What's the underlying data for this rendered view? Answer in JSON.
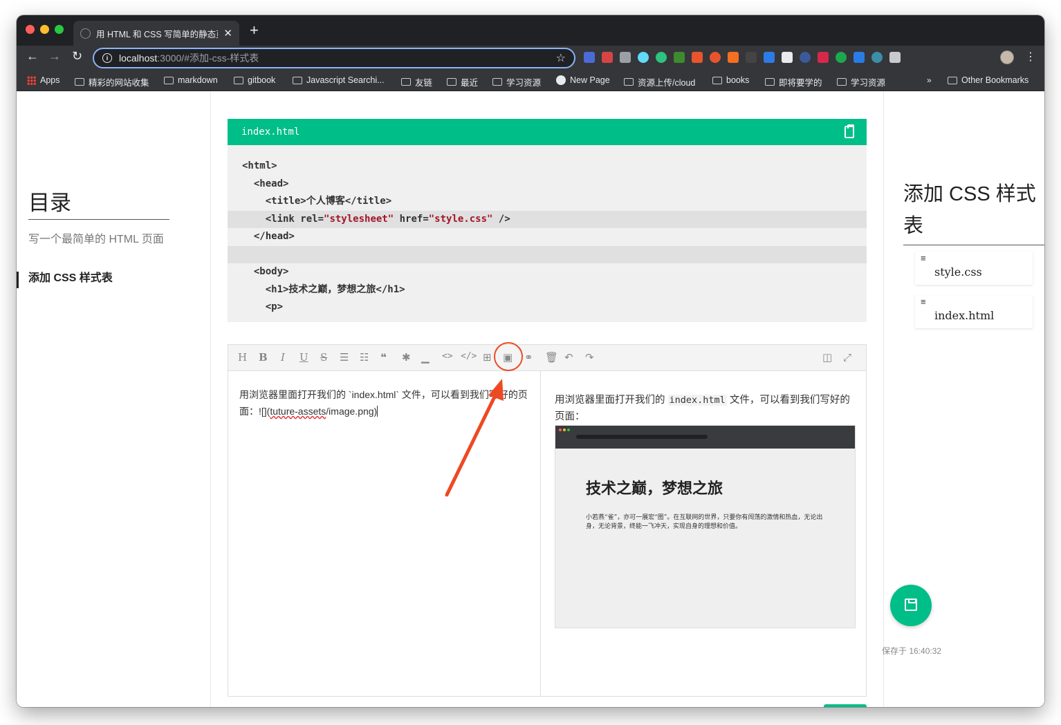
{
  "browser": {
    "tab_title": "用 HTML 和 CSS 写简单的静态页",
    "new_tab_symbol": "+",
    "close_symbol": "✕",
    "url_host": "localhost",
    "url_rest": ":3000/#添加-css-样式表",
    "bookmarks": [
      "Apps",
      "精彩的网站收集",
      "markdown",
      "gitbook",
      "Javascript Searchi...",
      "友链",
      "最近",
      "学习资源",
      "New Page",
      "资源上传/cloud",
      "books",
      "即将要学的",
      "学习资源",
      "»",
      "Other Bookmarks"
    ]
  },
  "toc": {
    "title": "目录",
    "items": [
      "写一个最简单的 HTML 页面",
      "添加 CSS 样式表"
    ]
  },
  "code": {
    "filename": "index.html",
    "lines": [
      "<html>",
      "  <head>",
      "    <title>个人博客</title>",
      "    <link rel=",
      "  </head>",
      "",
      "  <body>",
      "    <h1>技术之巅，梦想之旅</h1>",
      "    <p>"
    ],
    "link_rel_value": "\"stylesheet\"",
    "link_href_attr": " href=",
    "link_href_value": "\"style.css\"",
    "link_close": " />"
  },
  "editor": {
    "source_text_1": "用浏览器里面打开我们的 `index.html` 文件，可以看到我们写好的页面：![](",
    "source_text_link": "tuture-assets",
    "source_text_2": "/image.png)",
    "preview_text_1": "用浏览器里面打开我们的 ",
    "preview_code": "index.html",
    "preview_text_2": " 文件，可以看到我们写好的页面：",
    "preview_h1": "技术之巅，梦想之旅",
    "preview_p": "小若燕“雀”，亦可一展宏“图”。在互联网的世界，只要你有闯荡的激情和热血，无论出身，无论背景，终能一飞冲天，实现自身的理想和价值。"
  },
  "right_sidebar": {
    "title": "添加 CSS 样式表",
    "files": [
      "style.css",
      "index.html"
    ],
    "save_status": "保存于 16:40:32"
  },
  "colors": {
    "accent": "#00be88",
    "annotation": "#ee4922"
  }
}
